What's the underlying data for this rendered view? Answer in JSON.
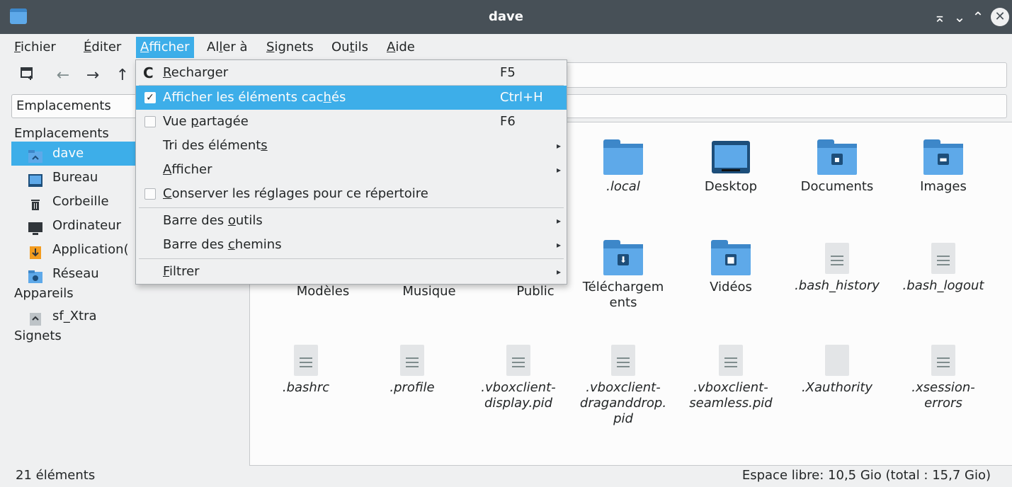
{
  "window": {
    "title": "dave"
  },
  "menubar": {
    "items": [
      {
        "pre": "",
        "u": "F",
        "post": "ichier"
      },
      {
        "pre": "",
        "u": "É",
        "post": "diter"
      },
      {
        "pre": "",
        "u": "A",
        "post": "fficher"
      },
      {
        "pre": "Al",
        "u": "l",
        "post": "er à"
      },
      {
        "pre": "",
        "u": "S",
        "post": "ignets"
      },
      {
        "pre": "Ou",
        "u": "t",
        "post": "ils"
      },
      {
        "pre": "",
        "u": "A",
        "post": "ide"
      }
    ]
  },
  "toolbar": {
    "new_tab_icon": "new-tab-icon",
    "back_icon": "←",
    "forward_icon": "→",
    "up_icon": "↑"
  },
  "places_combo": {
    "label": "Emplacements"
  },
  "sidebar": {
    "header_places": "Emplacements",
    "places": [
      {
        "label": "dave",
        "icon": "home-folder-icon",
        "selected": true
      },
      {
        "label": "Bureau",
        "icon": "desktop-icon"
      },
      {
        "label": "Corbeille",
        "icon": "trash-icon"
      },
      {
        "label": "Ordinateur",
        "icon": "computer-icon"
      },
      {
        "label": "Application(",
        "icon": "applications-icon"
      },
      {
        "label": "Réseau",
        "icon": "network-folder-icon"
      }
    ],
    "header_devices": "Appareils",
    "devices": [
      {
        "label": "sf_Xtra",
        "icon": "drive-icon"
      }
    ],
    "header_bookmarks": "Signets"
  },
  "view_menu": {
    "items": [
      {
        "pre": "",
        "u": "R",
        "post": "echarger",
        "shortcut": "F5",
        "kind": "reload"
      },
      {
        "pre": "Afficher les éléments cac",
        "u": "h",
        "post": "és",
        "shortcut": "Ctrl+H",
        "kind": "check",
        "checked": true,
        "highlighted": true
      },
      {
        "pre": "Vue ",
        "u": "p",
        "post": "artagée",
        "shortcut": "F6",
        "kind": "check",
        "checked": false
      },
      {
        "pre": "Tri des élément",
        "u": "s",
        "post": "",
        "kind": "submenu"
      },
      {
        "pre": "",
        "u": "A",
        "post": "fficher",
        "kind": "submenu"
      },
      {
        "pre": "",
        "u": "C",
        "post": "onserver les réglages pour ce répertoire",
        "kind": "check",
        "checked": false
      },
      {
        "pre": "Barre des ",
        "u": "o",
        "post": "utils",
        "kind": "submenu"
      },
      {
        "pre": "Barre des ",
        "u": "c",
        "post": "hemins",
        "kind": "submenu"
      },
      {
        "pre": "",
        "u": "F",
        "post": "iltrer",
        "kind": "submenu"
      }
    ]
  },
  "files": {
    "row1": [
      {
        "name": ".local",
        "type": "folder"
      },
      {
        "name": "Desktop",
        "type": "desktop"
      },
      {
        "name": "Documents",
        "type": "folder",
        "emblem": "▪"
      },
      {
        "name": "Images",
        "type": "folder",
        "emblem": "▬"
      }
    ],
    "row2": [
      {
        "name": "Modèles"
      },
      {
        "name": "Musique"
      },
      {
        "name": "Public"
      },
      {
        "name_lines": [
          "Téléchargem",
          "ents"
        ],
        "type": "folder",
        "emblem": "⬇"
      },
      {
        "name": "Vidéos",
        "type": "folder",
        "emblem": "■"
      },
      {
        "name": ".bash_history",
        "type": "doc"
      },
      {
        "name": ".bash_logout",
        "type": "doc"
      }
    ],
    "row3": [
      {
        "name_lines": [
          ".bashrc"
        ],
        "type": "doc"
      },
      {
        "name_lines": [
          ".profile"
        ],
        "type": "doc"
      },
      {
        "name_lines": [
          ".vboxclient-",
          "display.pid"
        ],
        "type": "doc"
      },
      {
        "name_lines": [
          ".vboxclient-",
          "draganddrop.",
          "pid"
        ],
        "type": "doc"
      },
      {
        "name_lines": [
          ".vboxclient-",
          "seamless.pid"
        ],
        "type": "doc"
      },
      {
        "name_lines": [
          ".Xauthority"
        ],
        "type": "blank"
      },
      {
        "name_lines": [
          ".xsession-",
          "errors"
        ],
        "type": "doc"
      }
    ]
  },
  "statusbar": {
    "count": "21 éléments",
    "free_space": "Espace libre: 10,5 Gio (total : 15,7 Gio)"
  },
  "colors": {
    "accent": "#3daee9",
    "titlebar": "#475057",
    "folder": "#5ea9e9"
  }
}
